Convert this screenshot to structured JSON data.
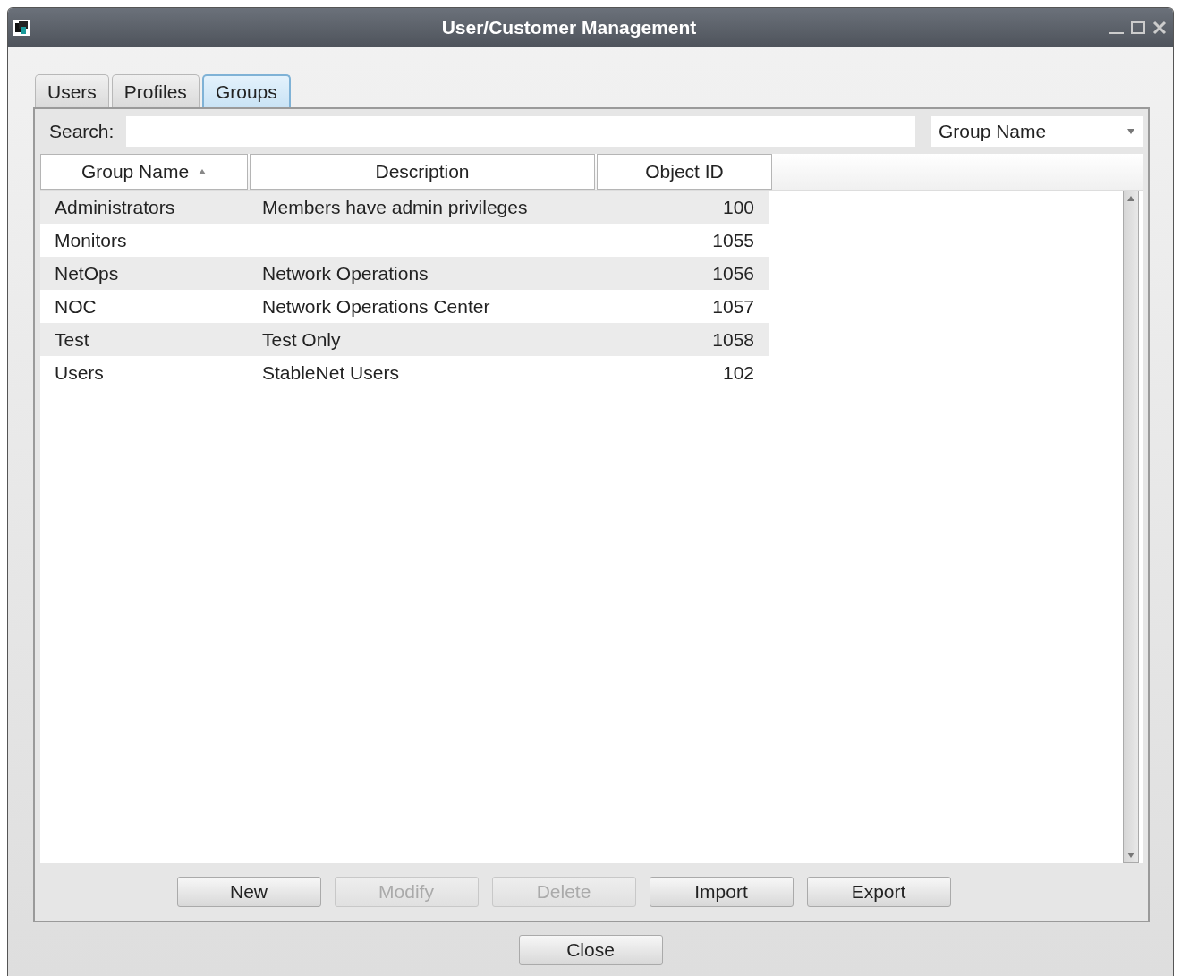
{
  "window": {
    "title": "User/Customer Management"
  },
  "tabs": [
    {
      "label": "Users",
      "selected": false
    },
    {
      "label": "Profiles",
      "selected": false
    },
    {
      "label": "Groups",
      "selected": true
    }
  ],
  "search": {
    "label": "Search:",
    "field_dropdown": "Group Name"
  },
  "table": {
    "columns": [
      {
        "label": "Group Name",
        "sorted": true
      },
      {
        "label": "Description",
        "sorted": false
      },
      {
        "label": "Object ID",
        "sorted": false
      }
    ],
    "rows": [
      {
        "cells": [
          "Administrators",
          "Members have admin privileges",
          "100"
        ]
      },
      {
        "cells": [
          "Monitors",
          "",
          "1055"
        ]
      },
      {
        "cells": [
          "NetOps",
          "Network Operations",
          "1056"
        ]
      },
      {
        "cells": [
          "NOC",
          "Network Operations Center",
          "1057"
        ]
      },
      {
        "cells": [
          "Test",
          "Test Only",
          "1058"
        ]
      },
      {
        "cells": [
          "Users",
          "StableNet Users",
          "102"
        ]
      }
    ]
  },
  "buttons": [
    {
      "label": "New",
      "disabled": false
    },
    {
      "label": "Modify",
      "disabled": true
    },
    {
      "label": "Delete",
      "disabled": true
    },
    {
      "label": "Import",
      "disabled": false
    },
    {
      "label": "Export",
      "disabled": false
    }
  ],
  "close_button": "Close"
}
